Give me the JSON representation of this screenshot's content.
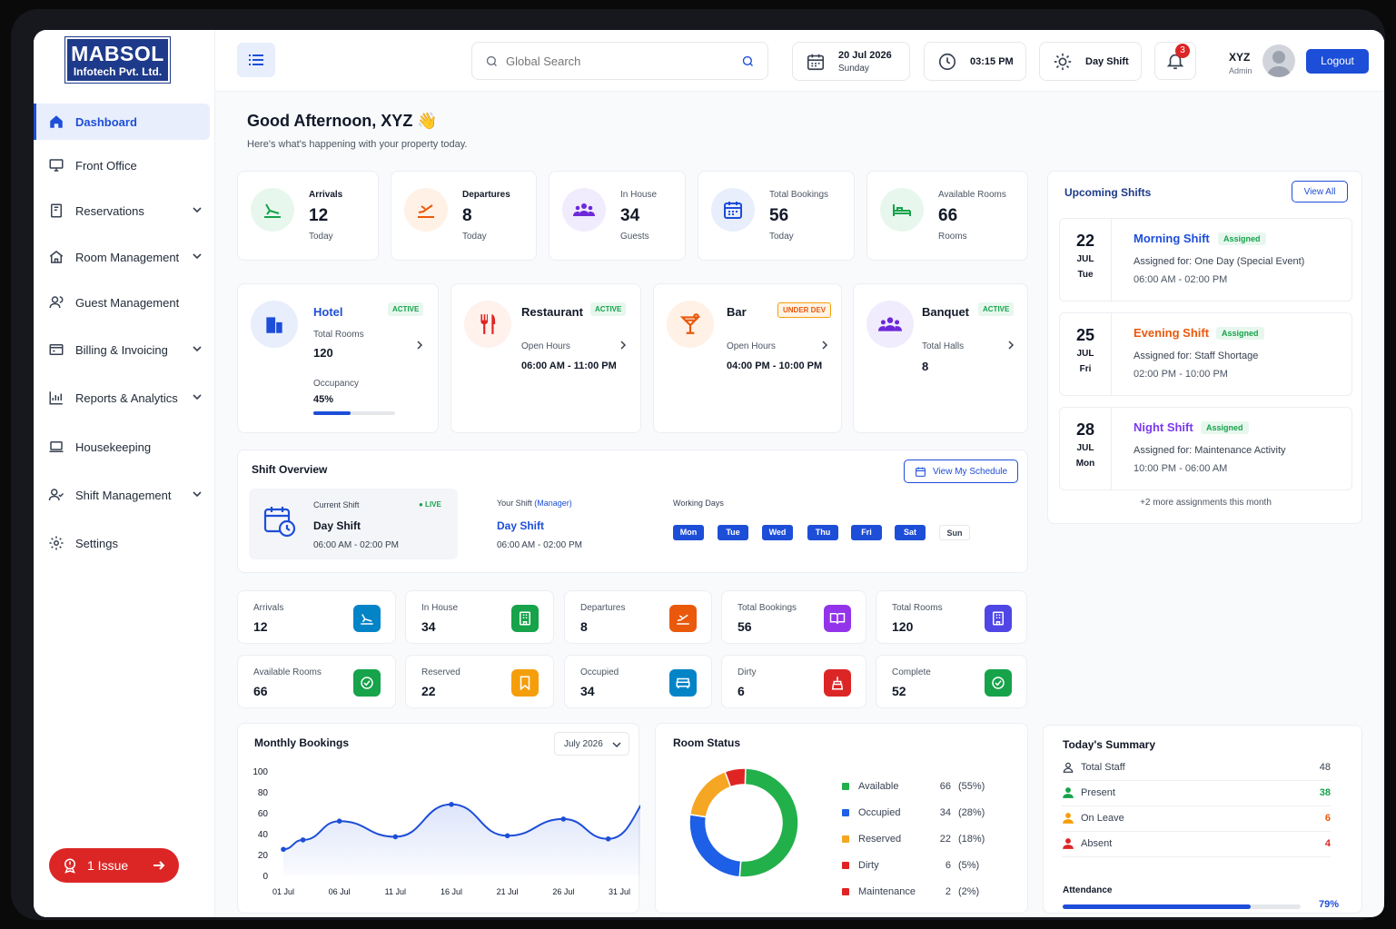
{
  "brand": {
    "line1": "MABSOL",
    "line2": "Infotech Pvt. Ltd."
  },
  "sidebar": {
    "items": [
      {
        "label": "Dashboard",
        "icon": "home-icon",
        "active": true
      },
      {
        "label": "Front Office",
        "icon": "monitor-icon"
      },
      {
        "label": "Reservations",
        "icon": "book-icon",
        "chevron": true
      },
      {
        "label": "Room Management",
        "icon": "house-icon",
        "chevron": true
      },
      {
        "label": "Guest Management",
        "icon": "guests-icon"
      },
      {
        "label": "Billing & Invoicing",
        "icon": "billing-icon",
        "chevron": true
      },
      {
        "label": "Reports & Analytics",
        "icon": "bar-chart-icon",
        "chevron": true
      },
      {
        "label": "Housekeeping",
        "icon": "laptop-icon"
      },
      {
        "label": "Shift Management",
        "icon": "users-icon",
        "chevron": true
      },
      {
        "label": "Settings",
        "icon": "gear-icon"
      }
    ],
    "issue_label": "1 Issue"
  },
  "topbar": {
    "search_placeholder": "Global Search",
    "date": "20 Jul 2026",
    "weekday": "Sunday",
    "time": "03:15 PM",
    "shift": "Day Shift",
    "notifications": "3",
    "user_name": "XYZ",
    "user_role": "Admin",
    "logout": "Logout"
  },
  "greeting": {
    "title": "Good Afternoon, XYZ 👋",
    "subtitle": "Here's what's happening with your property today."
  },
  "stats": [
    {
      "label": "Arrivals",
      "value": "12",
      "sub": "Today",
      "color": "#16a34a"
    },
    {
      "label": "Departures",
      "value": "8",
      "sub": "Today",
      "color": "#ea580c"
    },
    {
      "label": "In House",
      "value": "34",
      "sub": "Guests",
      "color": "#6d28d9"
    },
    {
      "label": "Total Bookings",
      "value": "56",
      "sub": "Today",
      "color": "#1d4ed8"
    },
    {
      "label": "Available Rooms",
      "value": "66",
      "sub": "Rooms",
      "color": "#16a34a"
    }
  ],
  "outlets": {
    "hotel": {
      "title": "Hotel",
      "status": "ACTIVE",
      "k1": "Total Rooms",
      "v1": "120",
      "k2": "Occupancy",
      "v2": "45%",
      "progress": 0.45
    },
    "restaurant": {
      "title": "Restaurant",
      "status": "ACTIVE",
      "k1": "Open Hours",
      "v1": "06:00 AM - 11:00 PM"
    },
    "bar": {
      "title": "Bar",
      "status": "UNDER DEV",
      "k1": "Open Hours",
      "v1": "04:00 PM - 10:00 PM"
    },
    "banquet": {
      "title": "Banquet",
      "status": "ACTIVE",
      "k1": "Total Halls",
      "v1": "8"
    }
  },
  "shift_overview": {
    "title": "Shift Overview",
    "button": "View My Schedule",
    "current_label": "Current Shift",
    "live": "● LIVE",
    "current_name": "Day Shift",
    "current_time": "06:00 AM - 02:00 PM",
    "your_label": "Your Shift",
    "your_role": "(Manager)",
    "your_name": "Day Shift",
    "your_time": "06:00 AM - 02:00 PM",
    "working_label": "Working Days",
    "days": [
      {
        "d": "Mon",
        "on": true
      },
      {
        "d": "Tue",
        "on": true
      },
      {
        "d": "Wed",
        "on": true
      },
      {
        "d": "Thu",
        "on": true
      },
      {
        "d": "Fri",
        "on": true
      },
      {
        "d": "Sat",
        "on": true
      },
      {
        "d": "Sun",
        "on": false
      }
    ]
  },
  "mini_stats": [
    {
      "label": "Arrivals",
      "value": "12",
      "color": "#0284c7"
    },
    {
      "label": "In House",
      "value": "34",
      "color": "#16a34a"
    },
    {
      "label": "Departures",
      "value": "8",
      "color": "#ea580c"
    },
    {
      "label": "Total Bookings",
      "value": "56",
      "color": "#9333ea"
    },
    {
      "label": "Total Rooms",
      "value": "120",
      "color": "#4f46e5"
    },
    {
      "label": "Available Rooms",
      "value": "66",
      "color": "#16a34a"
    },
    {
      "label": "Reserved",
      "value": "22",
      "color": "#f59e0b"
    },
    {
      "label": "Occupied",
      "value": "34",
      "color": "#0284c7"
    },
    {
      "label": "Dirty",
      "value": "6",
      "color": "#dc2626"
    },
    {
      "label": "Complete",
      "value": "52",
      "color": "#16a34a"
    }
  ],
  "upcoming": {
    "title": "Upcoming Shifts",
    "view_all": "View All",
    "items": [
      {
        "day": "22",
        "month": "JUL",
        "weekday": "Tue",
        "name": "Morning Shift",
        "color": "#1d4ed8",
        "status": "Assigned",
        "for_label": "Assigned for:",
        "for": "One Day (Special Event)",
        "time": "06:00 AM - 02:00 PM"
      },
      {
        "day": "25",
        "month": "JUL",
        "weekday": "Fri",
        "name": "Evening Shift",
        "color": "#ea580c",
        "status": "Assigned",
        "for_label": "Assigned for:",
        "for": "Staff Shortage",
        "time": "02:00 PM - 10:00 PM"
      },
      {
        "day": "28",
        "month": "JUL",
        "weekday": "Mon",
        "name": "Night Shift",
        "color": "#7c3aed",
        "status": "Assigned",
        "for_label": "Assigned for:",
        "for": "Maintenance Activity",
        "time": "10:00 PM - 06:00 AM"
      }
    ],
    "more": "+2 more assignments this month"
  },
  "monthly": {
    "title": "Monthly Bookings",
    "select": "July 2026"
  },
  "chart_data": [
    {
      "type": "area",
      "title": "Monthly Bookings",
      "x": [
        "01 Jul",
        "06 Jul",
        "11 Jul",
        "16 Jul",
        "21 Jul",
        "26 Jul",
        "31 Jul"
      ],
      "ylim": [
        0,
        100
      ],
      "yticks": [
        0,
        20,
        40,
        60,
        80,
        100
      ],
      "series": [
        {
          "points": [
            [
              0,
              25
            ],
            [
              0.35,
              34
            ],
            [
              1,
              52
            ],
            [
              2,
              37
            ],
            [
              3,
              68
            ],
            [
              4,
              38
            ],
            [
              5,
              54
            ],
            [
              5.8,
              35
            ],
            [
              6.8,
              84
            ]
          ]
        }
      ],
      "color": "#1d4ed8"
    },
    {
      "type": "pie",
      "title": "Room Status",
      "labels": [
        "Available",
        "Occupied",
        "Reserved",
        "Dirty",
        "Maintenance"
      ],
      "values": [
        66,
        34,
        22,
        6,
        2
      ],
      "percents": [
        "(55%)",
        "(28%)",
        "(18%)",
        "(5%)",
        "(2%)"
      ],
      "colors": [
        "#22b04b",
        "#1d5fe6",
        "#f5a623",
        "#e02424",
        "#e02424"
      ]
    }
  ],
  "summary": {
    "title": "Today's Summary",
    "rows": [
      {
        "label": "Total Staff",
        "value": "48",
        "color": "#111827",
        "icon": "person-icon"
      },
      {
        "label": "Present",
        "value": "38",
        "color": "#16a34a",
        "icon": "person-green-icon"
      },
      {
        "label": "On Leave",
        "value": "6",
        "color": "#ea580c",
        "icon": "person-orange-icon"
      },
      {
        "label": "Absent",
        "value": "4",
        "color": "#dc2626",
        "icon": "person-red-icon"
      }
    ],
    "attendance_label": "Attendance",
    "attendance": "79%",
    "attendance_value": 0.79
  }
}
